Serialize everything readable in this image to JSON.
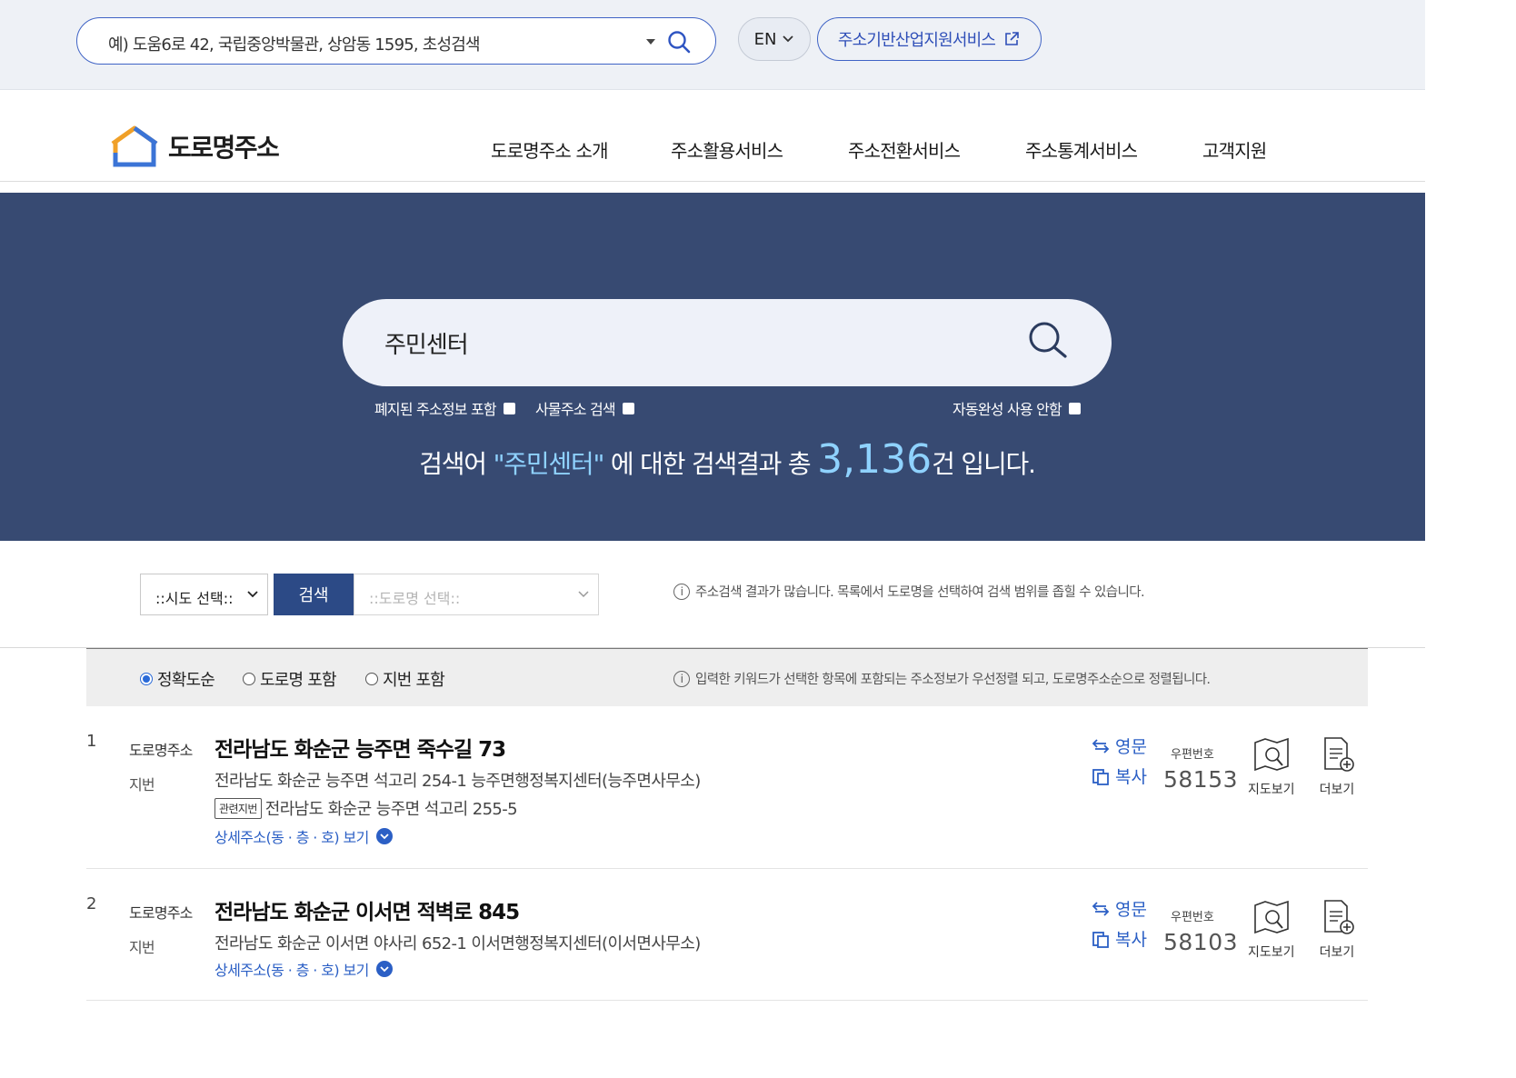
{
  "top": {
    "search_placeholder": "예) 도움6로 42, 국립중앙박물관, 상암동 1595, 초성검색",
    "lang_label": "EN",
    "ext_label": "주소기반산업지원서비스"
  },
  "header": {
    "logo_text": "도로명주소",
    "nav": [
      "도로명주소 소개",
      "주소활용서비스",
      "주소전환서비스",
      "주소통계서비스",
      "고객지원"
    ]
  },
  "hero": {
    "search_value": "주민센터",
    "options": {
      "include_abolished": "폐지된 주소정보 포함",
      "thing_address": "사물주소 검색",
      "no_autocomplete": "자동완성 사용 안함"
    },
    "result": {
      "prefix": "검색어 ",
      "keyword": "\"주민센터\"",
      "middle": " 에 대한 검색결과 총 ",
      "count": "3,136",
      "suffix": "건 입니다."
    }
  },
  "filter": {
    "sido_select": "::시도 선택::",
    "search_button": "검색",
    "road_select": "::도로명 선택::",
    "info": "주소검색 결과가 많습니다. 목록에서 도로명을 선택하여 검색 범위를 좁힐 수 있습니다."
  },
  "sort": {
    "options": [
      "정확도순",
      "도로명 포함",
      "지번 포함"
    ],
    "selected": "정확도순",
    "info": "입력한 키워드가 선택한 항목에 포함되는 주소정보가 우선정렬 되고, 도로명주소순으로 정렬됩니다."
  },
  "results": {
    "labels": {
      "road": "도로명주소",
      "jibun": "지번",
      "related": "관련지번",
      "detail": "상세주소(동 · 층 · 호) 보기",
      "english": "영문",
      "copy": "복사",
      "zip": "우편번호",
      "map": "지도보기",
      "more": "더보기"
    },
    "items": [
      {
        "num": "1",
        "road": "전라남도 화순군 능주면 죽수길 73",
        "jibun": "전라남도 화순군 능주면 석고리 254-1 능주면행정복지센터(능주면사무소)",
        "related": "전라남도 화순군 능주면 석고리 255-5",
        "zip": "58153"
      },
      {
        "num": "2",
        "road": "전라남도 화순군 이서면 적벽로 845",
        "jibun": "전라남도 화순군 이서면 야사리 652-1 이서면행정복지센터(이서면사무소)",
        "zip": "58103"
      }
    ]
  },
  "colors": {
    "hero_bg": "#374a72",
    "accent_blue": "#2b5fc5",
    "highlight": "#8fd2ff"
  }
}
